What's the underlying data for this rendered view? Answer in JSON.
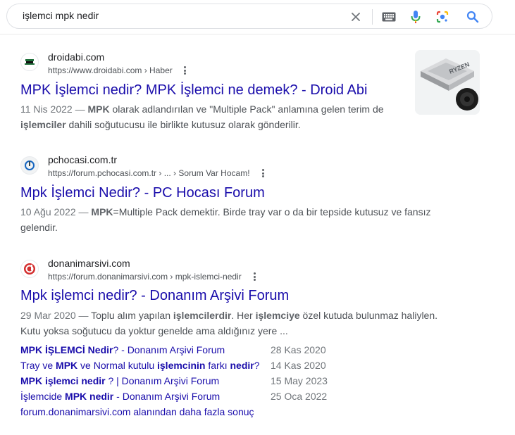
{
  "search": {
    "query": "işlemci mpk nedir",
    "icons": [
      "close-icon",
      "keyboard-icon",
      "microphone-icon",
      "lens-camera-icon",
      "search-icon"
    ]
  },
  "results": [
    {
      "site": "droidabi.com",
      "url": "https://www.droidabi.com › Haber",
      "title": "MPK İşlemci nedir? MPK İşlemci ne demek? - Droid Abi",
      "date": "11 Nis 2022",
      "snippet_parts": [
        {
          "t": "11 Nis 2022 — ",
          "b": false,
          "date": true
        },
        {
          "t": "MPK",
          "b": true
        },
        {
          "t": " olarak adlandırılan ve \"Multiple Pack\" anlamına gelen terim de ",
          "b": false
        },
        {
          "t": "işlemciler",
          "b": true
        },
        {
          "t": " dahili soğutucusu ile birlikte kutusuz olarak gönderilir.",
          "b": false
        }
      ],
      "thumbnail": "ryzen-cpu-with-cooler-image"
    },
    {
      "site": "pchocasi.com.tr",
      "url": "https://forum.pchocasi.com.tr › ... › Sorum Var Hocam!",
      "title": "Mpk İşlemci Nedir? - PC Hocası Forum",
      "snippet_parts": [
        {
          "t": "10 Ağu 2022 — ",
          "b": false,
          "date": true
        },
        {
          "t": "MPK",
          "b": true
        },
        {
          "t": "=Multiple Pack demektir. Birde tray var o da bir tepside kutusuz ve fansız gelendir.",
          "b": false
        }
      ]
    },
    {
      "site": "donanimarsivi.com",
      "url": "https://forum.donanimarsivi.com › mpk-islemci-nedir",
      "title": "Mpk işlemci nedir? - Donanım Arşivi Forum",
      "snippet_parts": [
        {
          "t": "29 Mar 2020 — ",
          "b": false,
          "date": true
        },
        {
          "t": "Toplu alım yapılan ",
          "b": false
        },
        {
          "t": "işlemcilerdir",
          "b": true
        },
        {
          "t": ". Her ",
          "b": false
        },
        {
          "t": "işlemciye",
          "b": true
        },
        {
          "t": " özel kutuda bulunmaz haliylen. Kutu yoksa soğutucu da yoktur genelde ama aldığınız yere ...",
          "b": false
        }
      ],
      "sublinks": [
        {
          "parts": [
            {
              "t": "MPK İŞLEMCİ Nedir",
              "b": true
            },
            {
              "t": "? - Donanım Arşivi Forum",
              "b": false
            }
          ],
          "date": "28 Kas 2020"
        },
        {
          "parts": [
            {
              "t": "Tray ve ",
              "b": false
            },
            {
              "t": "MPK",
              "b": true
            },
            {
              "t": " ve Normal kutulu ",
              "b": false
            },
            {
              "t": "işlemcinin",
              "b": true
            },
            {
              "t": " farkı ",
              "b": false
            },
            {
              "t": "nedir",
              "b": true
            },
            {
              "t": "?",
              "b": false
            }
          ],
          "date": "14 Kas 2020"
        },
        {
          "parts": [
            {
              "t": "MPK işlemci nedir",
              "b": true
            },
            {
              "t": " ? | Donanım Arşivi Forum",
              "b": false
            }
          ],
          "date": "15 May 2023"
        },
        {
          "parts": [
            {
              "t": "İşlemcide ",
              "b": false
            },
            {
              "t": "MPK nedir",
              "b": true
            },
            {
              "t": " - Donanım Arşivi Forum",
              "b": false
            }
          ],
          "date": "25 Oca 2022"
        }
      ],
      "more_link": "forum.donanimarsivi.com alanından daha fazla sonuç"
    }
  ],
  "colors": {
    "link": "#1a0dab",
    "snippet": "#4d5156",
    "mic_blue": "#4285f4",
    "mic_red": "#ea4335"
  }
}
